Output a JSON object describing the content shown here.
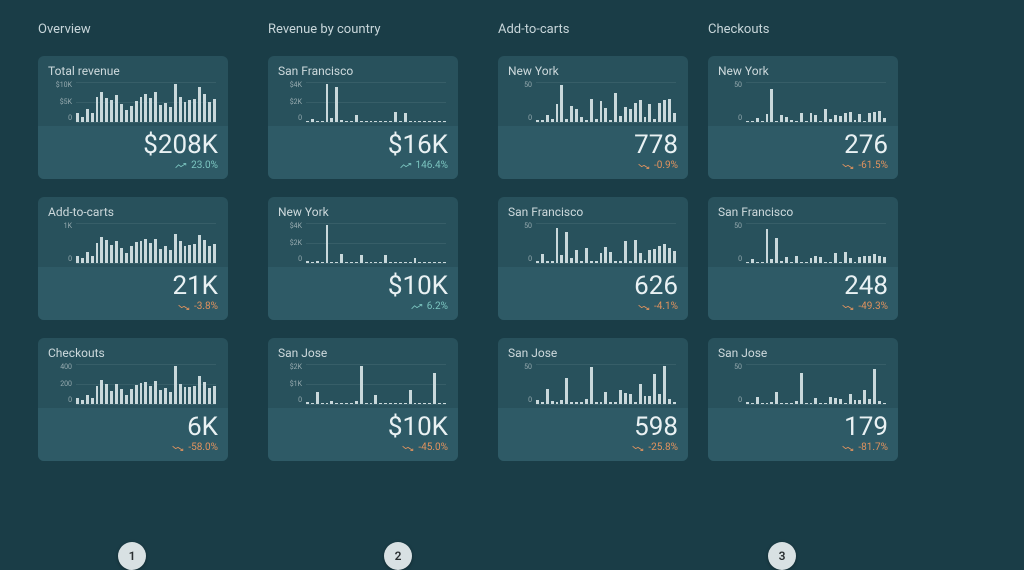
{
  "sections": {
    "overview": "Overview",
    "revenue_by_country": "Revenue by country",
    "add_to_carts": "Add-to-carts",
    "checkouts": "Checkouts"
  },
  "badges": {
    "one": "1",
    "two": "2",
    "three": "3"
  },
  "colors": {
    "up": "#7cc6c1",
    "down": "#e3935e",
    "bar": "#c9d8db"
  },
  "chart_data": [
    {
      "id": "overview.total_revenue",
      "type": "bar",
      "title": "Total revenue",
      "y_ticks": [
        "$10K",
        "$5K",
        "0"
      ],
      "ylim": [
        0,
        10000
      ],
      "values": [
        2200,
        1200,
        3200,
        2300,
        6300,
        7600,
        5900,
        5400,
        6700,
        4600,
        3000,
        4000,
        5200,
        6300,
        7100,
        6000,
        7500,
        4300,
        4800,
        3700,
        9600,
        6200,
        5000,
        5600,
        5700,
        8800,
        7100,
        5100,
        5700
      ],
      "metric": "$208K",
      "delta": "23.0%",
      "direction": "up"
    },
    {
      "id": "overview.add_to_carts",
      "type": "bar",
      "title": "Add-to-carts",
      "y_ticks": [
        "1K",
        "0"
      ],
      "ylim": [
        0,
        1200
      ],
      "values": [
        210,
        140,
        330,
        200,
        590,
        790,
        700,
        530,
        670,
        460,
        310,
        500,
        620,
        660,
        710,
        590,
        720,
        430,
        510,
        390,
        860,
        650,
        520,
        540,
        560,
        830,
        700,
        520,
        570
      ],
      "metric": "21K",
      "delta": "-3.8%",
      "direction": "down"
    },
    {
      "id": "overview.checkouts",
      "type": "bar",
      "title": "Checkouts",
      "y_ticks": [
        "400",
        "200",
        "0"
      ],
      "ylim": [
        0,
        400
      ],
      "values": [
        60,
        45,
        95,
        60,
        185,
        240,
        200,
        130,
        205,
        150,
        95,
        150,
        190,
        210,
        220,
        185,
        230,
        140,
        160,
        125,
        380,
        205,
        170,
        175,
        180,
        280,
        225,
        165,
        180
      ],
      "metric": "6K",
      "delta": "-58.0%",
      "direction": "down"
    },
    {
      "id": "rev.sf",
      "type": "bar",
      "title": "San Francisco",
      "y_ticks": [
        "$4K",
        "$2K",
        "0"
      ],
      "ylim": [
        0,
        4000
      ],
      "values": [
        40,
        260,
        60,
        40,
        3850,
        420,
        3550,
        200,
        80,
        40,
        680,
        60,
        40,
        40,
        40,
        40,
        60,
        40,
        1050,
        40,
        930,
        40,
        40,
        60,
        40,
        40,
        40,
        40,
        40
      ],
      "metric": "$16K",
      "delta": "146.4%",
      "direction": "up"
    },
    {
      "id": "rev.ny",
      "type": "bar",
      "title": "New York",
      "y_ticks": [
        "$4K",
        "$2K",
        "0"
      ],
      "ylim": [
        0,
        4500
      ],
      "values": [
        260,
        60,
        200,
        80,
        4300,
        40,
        40,
        1050,
        40,
        40,
        60,
        880,
        40,
        60,
        60,
        40,
        870,
        40,
        40,
        40,
        40,
        40,
        520,
        40,
        40,
        60,
        40,
        40,
        40
      ],
      "metric": "$10K",
      "delta": "6.2%",
      "direction": "up"
    },
    {
      "id": "rev.sj",
      "type": "bar",
      "title": "San Jose",
      "y_ticks": [
        "$2K",
        "$1K",
        "0"
      ],
      "ylim": [
        0,
        2200
      ],
      "values": [
        120,
        60,
        660,
        60,
        80,
        140,
        60,
        60,
        40,
        40,
        150,
        2100,
        60,
        40,
        520,
        40,
        60,
        60,
        40,
        60,
        40,
        780,
        40,
        60,
        60,
        60,
        1700,
        40,
        40
      ],
      "metric": "$10K",
      "delta": "-45.0%",
      "direction": "down"
    },
    {
      "id": "atc.ny",
      "type": "bar",
      "title": "New York",
      "y_ticks": [
        "50",
        "0"
      ],
      "ylim": [
        0,
        70
      ],
      "values": [
        4,
        4,
        12,
        5,
        32,
        65,
        6,
        28,
        22,
        8,
        4,
        40,
        5,
        37,
        25,
        4,
        50,
        10,
        27,
        22,
        33,
        38,
        8,
        31,
        6,
        33,
        39,
        41,
        15
      ],
      "metric": "778",
      "delta": "-0.9%",
      "direction": "down"
    },
    {
      "id": "atc.sf",
      "type": "bar",
      "title": "San Francisco",
      "y_ticks": [
        "50",
        "0"
      ],
      "ylim": [
        0,
        70
      ],
      "values": [
        4,
        15,
        4,
        4,
        62,
        14,
        54,
        8,
        22,
        4,
        26,
        4,
        4,
        18,
        28,
        20,
        4,
        4,
        38,
        4,
        41,
        18,
        6,
        22,
        25,
        29,
        33,
        26,
        21
      ],
      "metric": "626",
      "delta": "-4.1%",
      "direction": "down"
    },
    {
      "id": "atc.sj",
      "type": "bar",
      "title": "San Jose",
      "y_ticks": [
        "50",
        "0"
      ],
      "ylim": [
        0,
        80
      ],
      "values": [
        8,
        4,
        30,
        6,
        4,
        8,
        53,
        4,
        4,
        4,
        10,
        74,
        5,
        4,
        24,
        4,
        4,
        28,
        22,
        20,
        4,
        41,
        16,
        16,
        60,
        20,
        76,
        10,
        4
      ],
      "metric": "598",
      "delta": "-25.8%",
      "direction": "down"
    },
    {
      "id": "chk.ny",
      "type": "bar",
      "title": "New York",
      "y_ticks": [
        "50",
        "0"
      ],
      "ylim": [
        0,
        55
      ],
      "values": [
        1,
        1,
        5,
        2,
        11,
        46,
        2,
        9,
        7,
        3,
        1,
        13,
        2,
        13,
        9,
        1,
        18,
        4,
        9,
        8,
        12,
        14,
        3,
        11,
        2,
        12,
        14,
        15,
        6
      ],
      "metric": "276",
      "delta": "-61.5%",
      "direction": "down"
    },
    {
      "id": "chk.sf",
      "type": "bar",
      "title": "San Francisco",
      "y_ticks": [
        "50",
        "0"
      ],
      "ylim": [
        0,
        55
      ],
      "values": [
        1,
        6,
        1,
        1,
        47,
        6,
        35,
        3,
        8,
        1,
        9,
        1,
        1,
        7,
        10,
        8,
        1,
        1,
        14,
        1,
        15,
        7,
        2,
        8,
        9,
        10,
        12,
        9,
        8
      ],
      "metric": "248",
      "delta": "-49.3%",
      "direction": "down"
    },
    {
      "id": "chk.sj",
      "type": "bar",
      "title": "San Jose",
      "y_ticks": [
        "50",
        "0"
      ],
      "ylim": [
        0,
        55
      ],
      "values": [
        3,
        1,
        10,
        2,
        1,
        3,
        17,
        1,
        1,
        1,
        4,
        42,
        2,
        1,
        8,
        1,
        1,
        9,
        8,
        7,
        1,
        14,
        6,
        6,
        19,
        7,
        48,
        4,
        1
      ],
      "metric": "179",
      "delta": "-81.7%",
      "direction": "down"
    }
  ]
}
